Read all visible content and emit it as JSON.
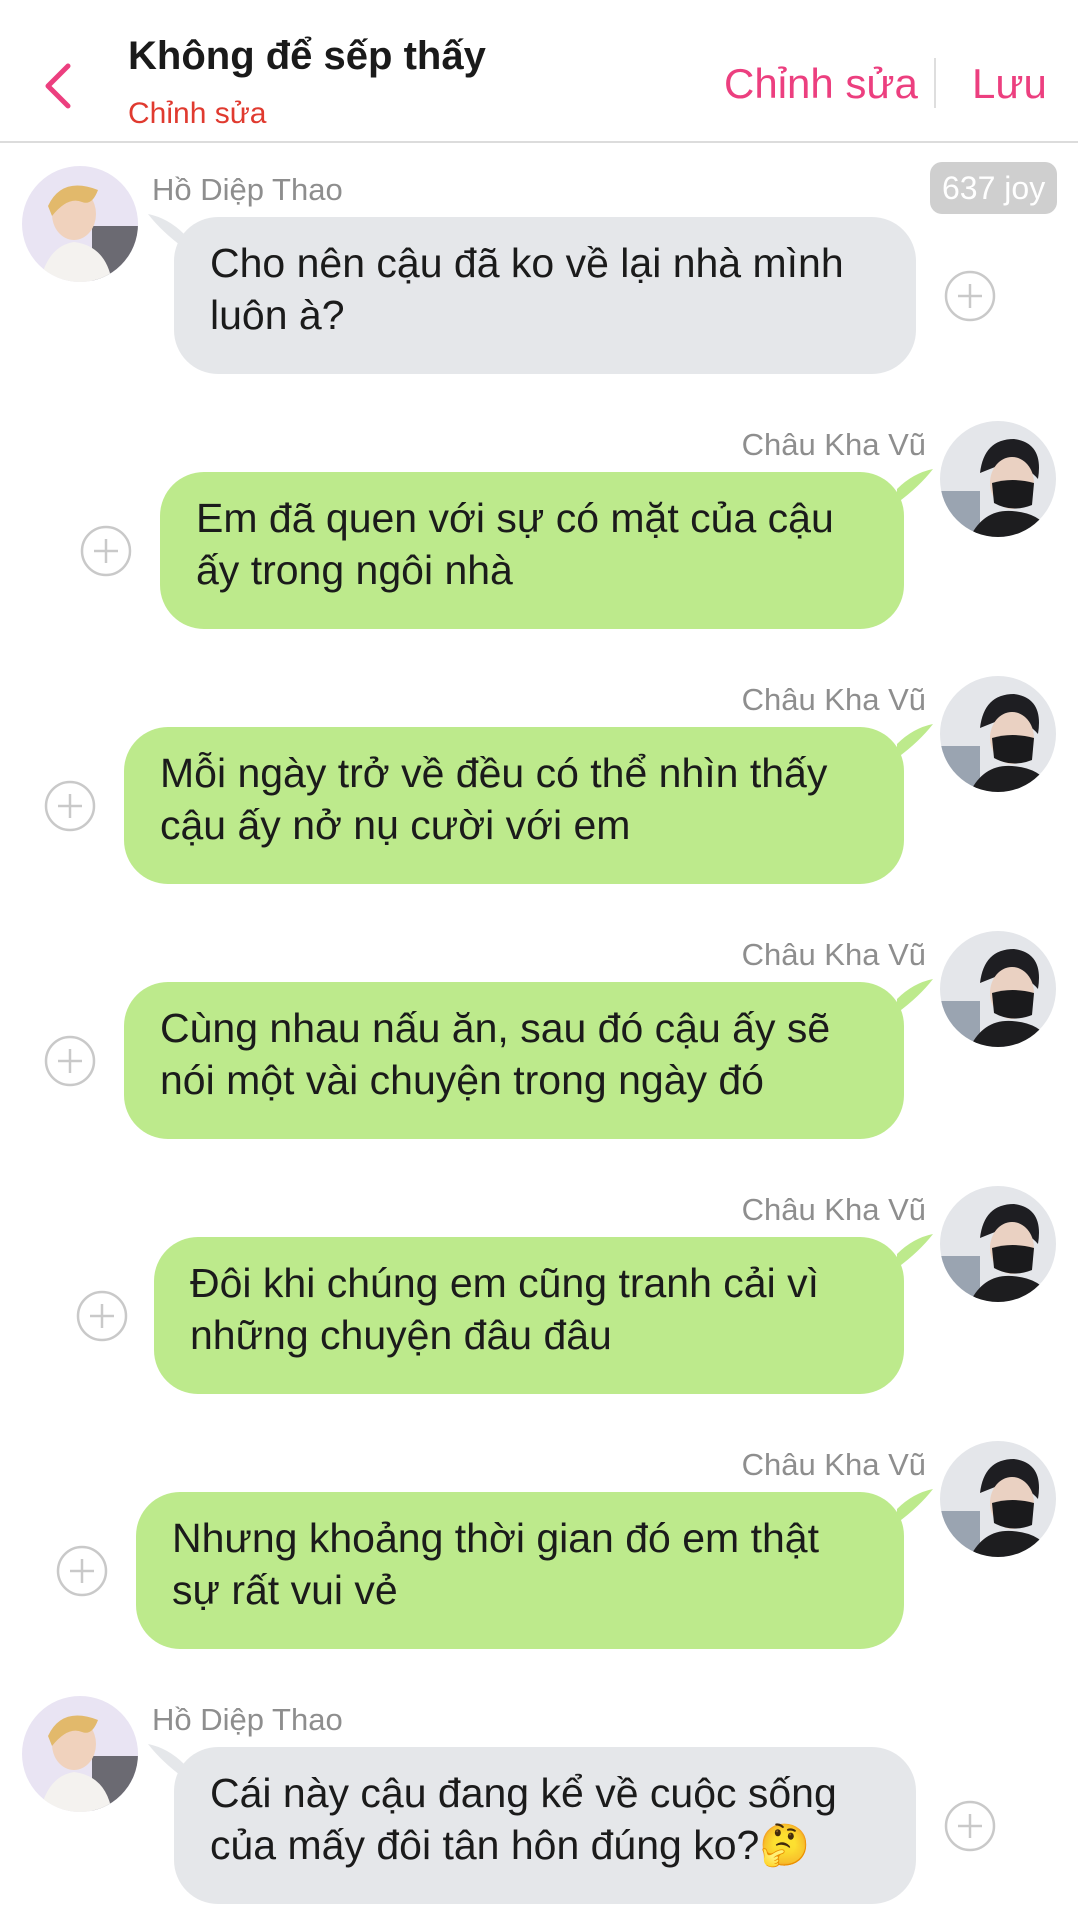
{
  "header": {
    "title": "Không để sếp thấy",
    "subtitle": "Chỉnh sửa",
    "edit_label": "Chỉnh sửa",
    "save_label": "Lưu",
    "back_icon": "chevron-left-icon",
    "accent_color": "#ec3f7f",
    "subtitle_color": "#e03a2f"
  },
  "joy_badge": "637 joy",
  "colors": {
    "incoming_bubble": "#e5e7ea",
    "outgoing_bubble": "#bdea8c"
  },
  "messages": [
    {
      "sender": "Hồ Diệp Thao",
      "side": "incoming",
      "text": "Cho nên cậu đã ko về lại nhà mình luôn à?"
    },
    {
      "sender": "Châu Kha Vũ",
      "side": "outgoing",
      "text": "Em đã quen với sự có mặt của cậu ấy trong ngôi nhà"
    },
    {
      "sender": "Châu Kha Vũ",
      "side": "outgoing",
      "text": "Mỗi ngày trở về đều có thể nhìn thấy cậu ấy nở nụ cười với em"
    },
    {
      "sender": "Châu Kha Vũ",
      "side": "outgoing",
      "text": "Cùng nhau nấu ăn, sau đó cậu ấy sẽ nói một vài chuyện trong ngày đó"
    },
    {
      "sender": "Châu Kha Vũ",
      "side": "outgoing",
      "text": "Đôi khi chúng em cũng tranh cải vì những chuyện đâu đâu"
    },
    {
      "sender": "Châu Kha Vũ",
      "side": "outgoing",
      "text": "Nhưng khoảng thời gian đó em thật sự rất vui vẻ"
    },
    {
      "sender": "Hồ Diệp Thao",
      "side": "incoming",
      "text": "Cái này cậu đang kể về cuộc sống của mấy đôi tân hôn đúng ko?🤔"
    }
  ]
}
